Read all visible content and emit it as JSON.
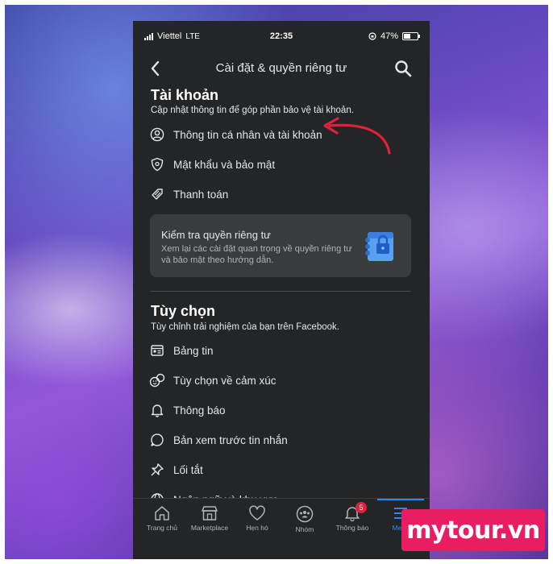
{
  "status_bar": {
    "carrier": "Viettel",
    "network": "LTE",
    "time": "22:35",
    "battery": "47%"
  },
  "header": {
    "title": "Cài đặt & quyền riêng tư",
    "back_icon": "chevron-left-icon",
    "search_icon": "search-icon"
  },
  "account": {
    "title": "Tài khoản",
    "subtitle": "Cập nhật thông tin để góp phần bảo vệ tài khoản.",
    "items": [
      {
        "label": "Thông tin cá nhân và tài khoản",
        "icon": "person-circle-icon"
      },
      {
        "label": "Mật khẩu và bảo mật",
        "icon": "shield-icon"
      },
      {
        "label": "Thanh toán",
        "icon": "tag-icon"
      }
    ]
  },
  "privacy_checkup": {
    "title": "Kiểm tra quyền riêng tư",
    "description": "Xem lại các cài đặt quan trọng về quyền riêng tư và bảo mật theo hướng dẫn.",
    "icon": "privacy-lock-icon"
  },
  "preferences": {
    "title": "Tùy chọn",
    "subtitle": "Tùy chỉnh trải nghiệm của bạn trên Facebook.",
    "items": [
      {
        "label": "Bảng tin",
        "icon": "news-feed-icon"
      },
      {
        "label": "Tùy chọn về cảm xúc",
        "icon": "reactions-icon"
      },
      {
        "label": "Thông báo",
        "icon": "bell-icon"
      },
      {
        "label": "Bản xem trước tin nhắn",
        "icon": "message-preview-icon"
      },
      {
        "label": "Lối tắt",
        "icon": "pin-icon"
      },
      {
        "label": "Ngôn ngữ và khu vực",
        "icon": "globe-icon"
      }
    ]
  },
  "tab_bar": {
    "tabs": [
      {
        "label": "Trang chủ",
        "icon": "home-icon"
      },
      {
        "label": "Marketplace",
        "icon": "marketplace-icon"
      },
      {
        "label": "Hẹn hò",
        "icon": "dating-heart-icon"
      },
      {
        "label": "Nhóm",
        "icon": "groups-icon"
      },
      {
        "label": "Thông báo",
        "icon": "bell-icon",
        "badge": "5"
      },
      {
        "label": "Menu",
        "icon": "menu-icon",
        "active": true
      }
    ]
  },
  "watermark": {
    "text": "mytour.vn"
  },
  "colors": {
    "background": "#242526",
    "card": "#3a3b3c",
    "accent": "#2d88ff",
    "arrow": "#e0223a",
    "badge": "#e41e3f",
    "watermark": "#ea1d63"
  }
}
